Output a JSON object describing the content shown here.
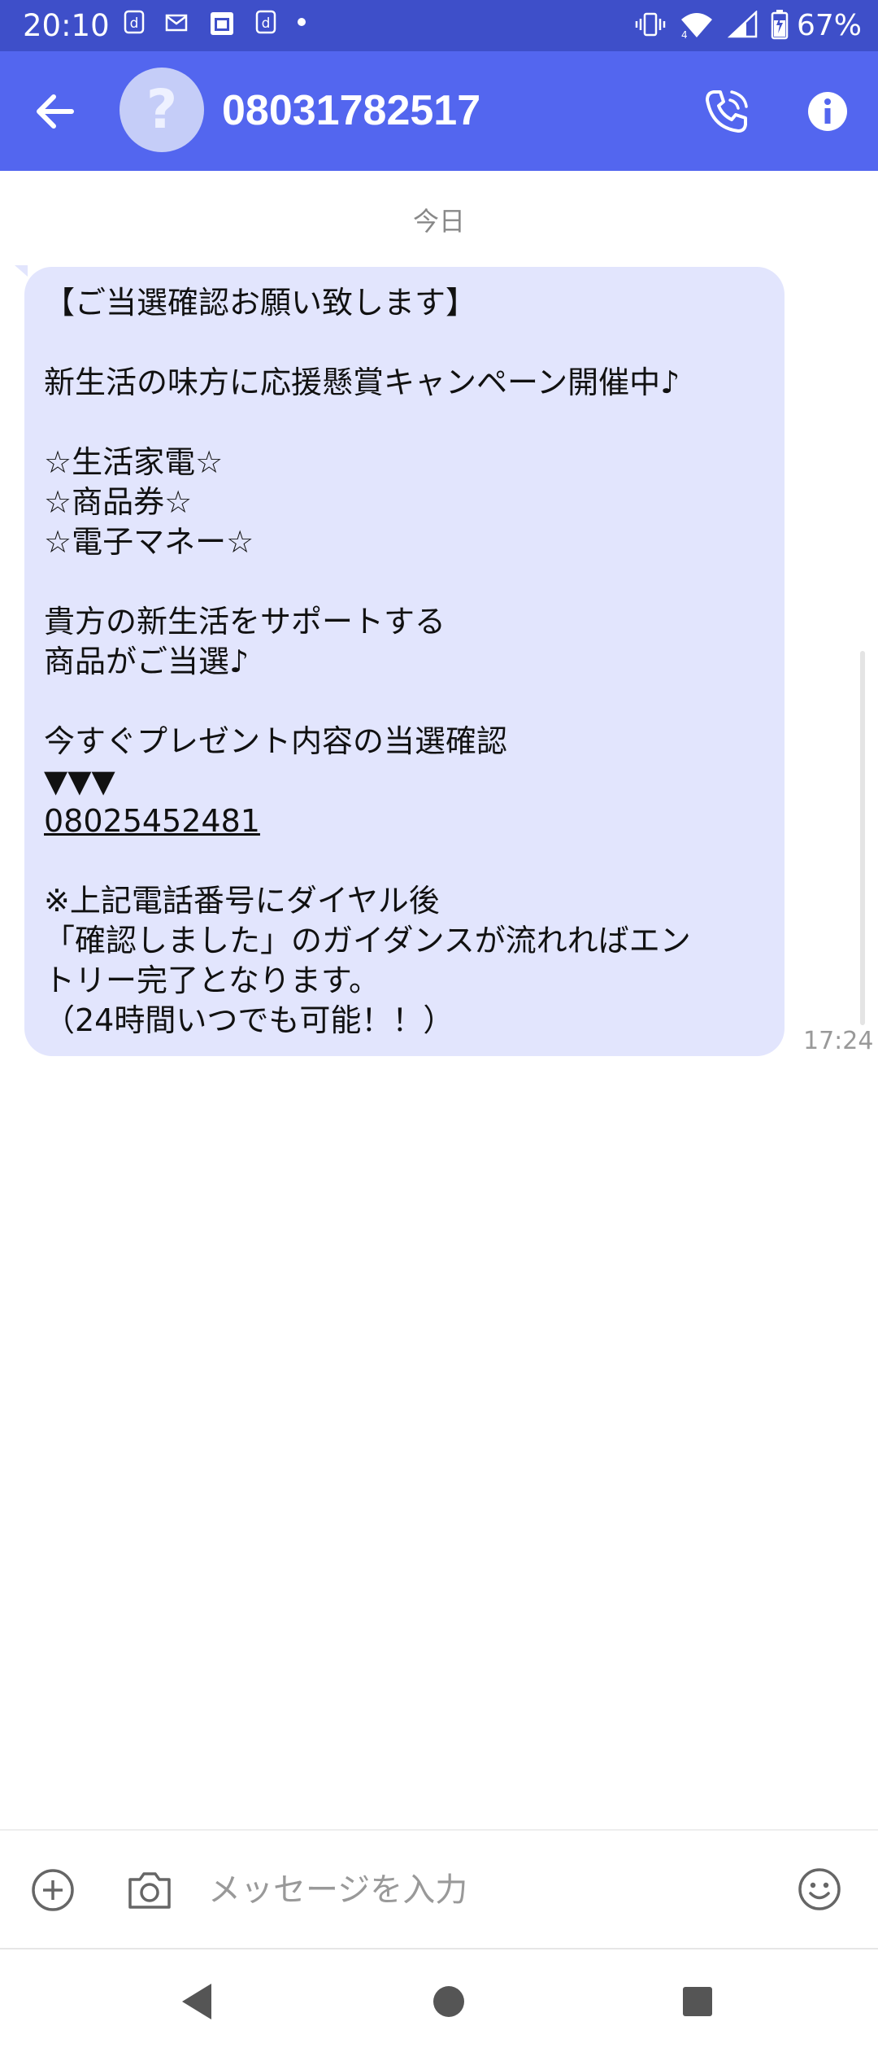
{
  "status_bar": {
    "time": "20:10",
    "notification_icons": [
      "docomo-icon",
      "mail-icon",
      "calendar-icon",
      "docomo-icon",
      "dot-icon"
    ],
    "battery_percent": "67%",
    "network_badge": "4"
  },
  "header": {
    "contact": "08031782517",
    "avatar_placeholder": "?"
  },
  "conversation": {
    "date_divider": "今日",
    "message": {
      "lines": [
        "【ご当選確認お願い致します】",
        "",
        "新生活の味方に応援懸賞キャンペーン開催中♪",
        "",
        "☆生活家電☆",
        "☆商品券☆",
        "☆電子マネー☆",
        "",
        "貴方の新生活をサポートする",
        "商品がご当選♪",
        "",
        "今すぐプレゼント内容の当選確認",
        "▼▼▼",
        "08025452481",
        "",
        "※上記電話番号にダイヤル後",
        "「確認しました」のガイダンスが流れればエン",
        "トリー完了となります。",
        "（24時間いつでも可能！！）"
      ],
      "time": "17:24"
    }
  },
  "composer": {
    "placeholder": "メッセージを入力"
  },
  "colors": {
    "status_bar": "#3e4fc9",
    "app_bar": "#5366ef",
    "bubble": "#e2e5fd",
    "avatar": "#c5cdf8"
  }
}
